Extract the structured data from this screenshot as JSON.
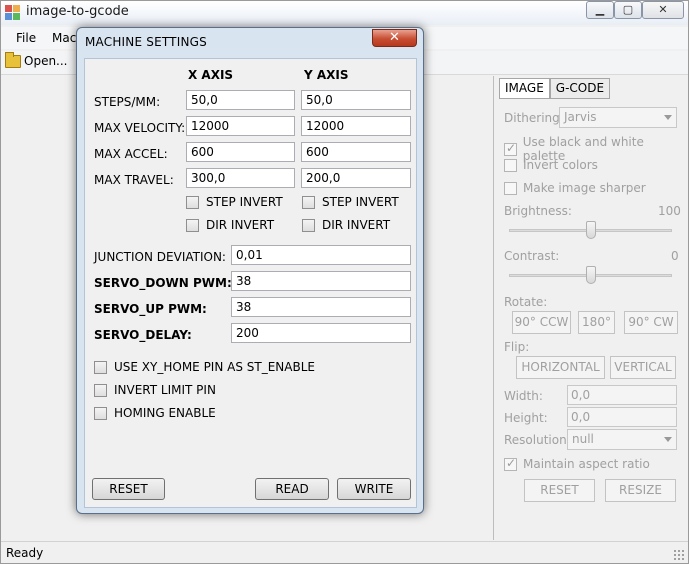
{
  "window": {
    "title": "image-to-gcode"
  },
  "menu": {
    "file": "File",
    "machine": "Mach"
  },
  "toolbar": {
    "open": "Open..."
  },
  "dialog": {
    "title": "MACHINE SETTINGS",
    "close_glyph": "✕",
    "headers": {
      "x": "X AXIS",
      "y": "Y AXIS"
    },
    "rows": [
      {
        "label": "STEPS/MM:",
        "x": "50,0",
        "y": "50,0"
      },
      {
        "label": "MAX VELOCITY:",
        "x": "12000",
        "y": "12000"
      },
      {
        "label": "MAX ACCEL:",
        "x": "600",
        "y": "600"
      },
      {
        "label": "MAX TRAVEL:",
        "x": "300,0",
        "y": "200,0"
      }
    ],
    "step_invert": "STEP INVERT",
    "dir_invert": "DIR INVERT",
    "junction": {
      "label": "JUNCTION DEVIATION:",
      "value": "0,01"
    },
    "servo_down": {
      "label": "SERVO_DOWN PWM:",
      "value": "38"
    },
    "servo_up": {
      "label": "SERVO_UP PWM:",
      "value": "38"
    },
    "servo_delay": {
      "label": "SERVO_DELAY:",
      "value": "200"
    },
    "options": {
      "xy_home": "USE XY_HOME PIN AS ST_ENABLE",
      "invert_limit": "INVERT LIMIT PIN",
      "homing": "HOMING ENABLE"
    },
    "buttons": {
      "reset": "RESET",
      "read": "READ",
      "write": "WRITE"
    }
  },
  "panel": {
    "tabs": {
      "image": "IMAGE",
      "gcode": "G-CODE"
    },
    "dithering": {
      "label": "Dithering:",
      "value": "Jarvis"
    },
    "use_bw": "Use black and white palette",
    "invert_colors": "Invert colors",
    "sharper": "Make image sharper",
    "brightness": {
      "label": "Brightness:",
      "value": "100",
      "level": 0.5
    },
    "contrast": {
      "label": "Contrast:",
      "value": "0",
      "level": 0.5
    },
    "rotate": {
      "label": "Rotate:",
      "ccw": "90° CCW",
      "r180": "180°",
      "cw": "90° CW"
    },
    "flip": {
      "label": "Flip:",
      "horizontal": "HORIZONTAL",
      "vertical": "VERTICAL"
    },
    "width": {
      "label": "Width:",
      "value": "0,0"
    },
    "height": {
      "label": "Height:",
      "value": "0,0"
    },
    "resolution": {
      "label": "Resolution:",
      "value": "null"
    },
    "aspect": "Maintain aspect ratio",
    "reset": "RESET",
    "resize": "RESIZE"
  },
  "status": {
    "text": "Ready"
  },
  "colors": {
    "dialog_frame": "#d9e4f1",
    "close_button": "#c74e33",
    "disabled_text": "#a0a0a0"
  }
}
